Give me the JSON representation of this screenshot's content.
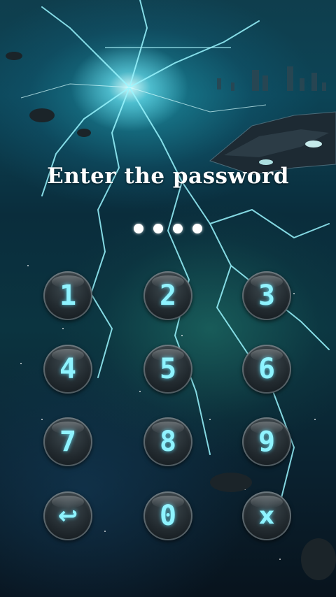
{
  "prompt": "Enter the password",
  "pin": {
    "entered_count": 4
  },
  "keypad": {
    "keys": [
      "1",
      "2",
      "3",
      "4",
      "5",
      "6",
      "7",
      "8",
      "9",
      "↩",
      "0",
      "x"
    ]
  },
  "icons": {
    "back": "back-arrow-icon",
    "delete": "close-icon"
  },
  "colors": {
    "digit": "#8ef3ff",
    "text": "#ffffff"
  }
}
